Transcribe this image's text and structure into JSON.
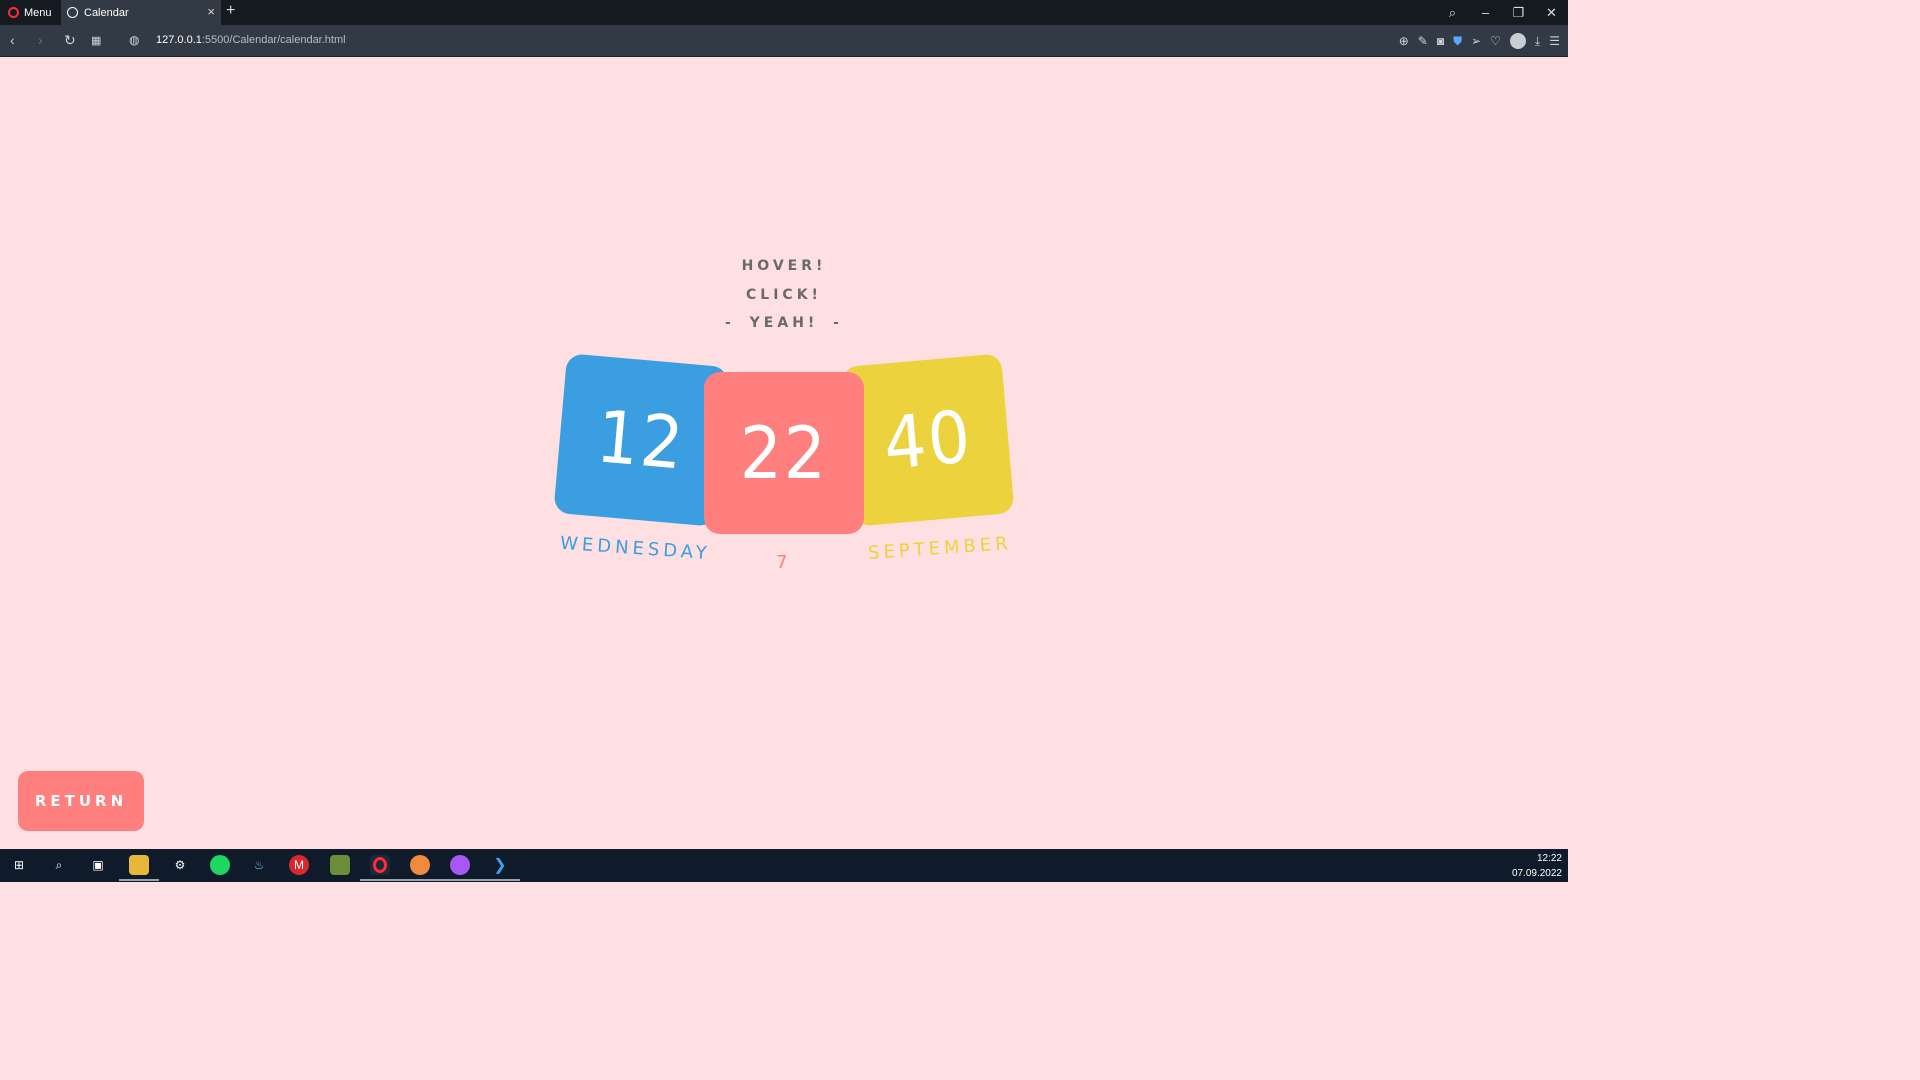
{
  "browser": {
    "menu_label": "Menu",
    "tab_title": "Calendar",
    "tab_close": "×",
    "new_tab": "+",
    "url_host": "127.0.0.1",
    "url_rest": ":5500/Calendar/calendar.html"
  },
  "page": {
    "tagline": [
      "HOVER!",
      "CLICK!",
      "- YEAH! -"
    ],
    "hours": "12",
    "minutes": "22",
    "seconds": "40",
    "day_name": "WEDNESDAY",
    "day_number": "7",
    "month": "SEPTEMBER",
    "return_label": "RETURN",
    "colors": {
      "background": "#ffe0e2",
      "hours": "#3a9ee0",
      "minutes": "#fe7f7e",
      "seconds": "#ecd33e"
    }
  },
  "taskbar": {
    "time": "12:22",
    "date": "07.09.2022",
    "apps": [
      "windows-start",
      "search",
      "task-view",
      "file-explorer",
      "steelseries",
      "spotify",
      "steam",
      "mega",
      "minecraft",
      "opera",
      "discord",
      "messenger",
      "vscode"
    ]
  }
}
